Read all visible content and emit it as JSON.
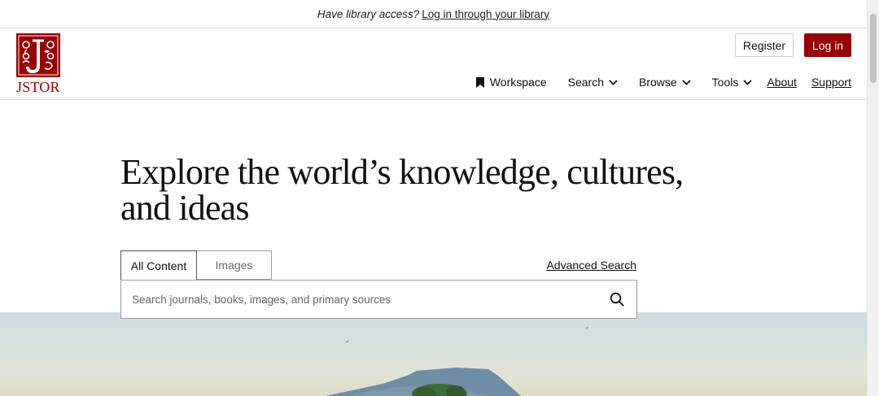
{
  "banner": {
    "question": "Have library access?",
    "link": "Log in through your library"
  },
  "logo": {
    "text": "JSTOR"
  },
  "header": {
    "register_label": "Register",
    "login_label": "Log in"
  },
  "nav": {
    "workspace": "Workspace",
    "search": "Search",
    "browse": "Browse",
    "tools": "Tools",
    "about": "About",
    "support": "Support"
  },
  "hero": {
    "title_line1": "Explore the world’s knowledge, cultures,",
    "title_line2": "and ideas"
  },
  "search": {
    "tabs": [
      {
        "label": "All Content",
        "active": true
      },
      {
        "label": "Images",
        "active": false
      }
    ],
    "advanced_label": "Advanced Search",
    "placeholder": "Search journals, books, images, and primary sources"
  },
  "colors": {
    "brand": "#990000",
    "border": "#9a9a9a"
  }
}
